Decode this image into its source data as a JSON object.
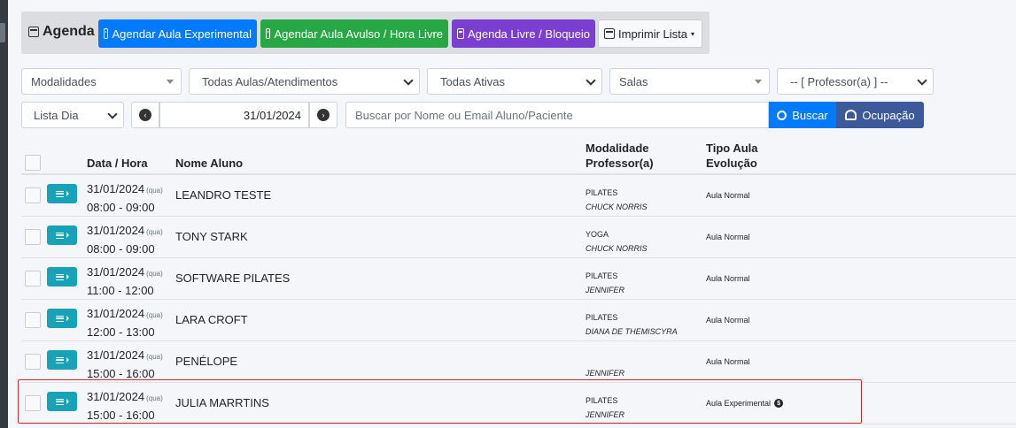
{
  "header": {
    "title": "Agenda",
    "buttons": {
      "experimental": "Agendar Aula Experimental",
      "avulso": "Agendar Aula Avulso / Hora Livre",
      "livre": "Agenda Livre / Bloqueio",
      "imprimir": "Imprimir Lista"
    }
  },
  "filters": {
    "modalidades": "Modalidades",
    "aulas": "Todas Aulas/Atendimentos",
    "ativas": "Todas Ativas",
    "salas": "Salas",
    "professor": "-- [ Professor(a) ] --",
    "view": "Lista Dia",
    "date": "31/01/2024",
    "search_placeholder": "Buscar por Nome ou Email Aluno/Paciente",
    "search_button": "Buscar",
    "ocupacao_button": "Ocupação"
  },
  "table": {
    "headers": {
      "datahora": "Data / Hora",
      "nome": "Nome Aluno",
      "modalidade": "Modalidade",
      "professor": "Professor(a)",
      "tipo": "Tipo Aula",
      "evolucao": "Evolução"
    },
    "rows": [
      {
        "date": "31/01/2024",
        "day": "(qua)",
        "time": "08:00 - 09:00",
        "name": "LEANDRO TESTE",
        "modalidade": "PILATES",
        "professor": "CHUCK NORRIS",
        "tipo": "Aula Normal"
      },
      {
        "date": "31/01/2024",
        "day": "(qua)",
        "time": "08:00 - 09:00",
        "name": "TONY STARK",
        "modalidade": "YOGA",
        "professor": "CHUCK NORRIS",
        "tipo": "Aula Normal"
      },
      {
        "date": "31/01/2024",
        "day": "(qua)",
        "time": "11:00 - 12:00",
        "name": "SOFTWARE PILATES",
        "modalidade": "PILATES",
        "professor": "JENNIFER",
        "tipo": "Aula Normal"
      },
      {
        "date": "31/01/2024",
        "day": "(qua)",
        "time": "12:00 - 13:00",
        "name": "LARA CROFT",
        "modalidade": "PILATES",
        "professor": "DIANA DE THEMISCYRA",
        "tipo": "Aula Normal"
      },
      {
        "date": "31/01/2024",
        "day": "(qua)",
        "time": "15:00 - 16:00",
        "name": "PENÉLOPE",
        "modalidade": "",
        "professor": "JENNIFER",
        "tipo": "Aula Normal"
      },
      {
        "date": "31/01/2024",
        "day": "(qua)",
        "time": "15:00 - 16:00",
        "name": "JULIA MARRTINS",
        "modalidade": "PILATES",
        "professor": "JENNIFER",
        "tipo": "Aula Experimental",
        "paid_icon": "$"
      }
    ]
  },
  "colors": {
    "blue": "#007bff",
    "green": "#28a745",
    "purple": "#7a3fd1",
    "teal": "#17a2b8",
    "navy": "#3c5a99",
    "highlight": "#d62828"
  }
}
